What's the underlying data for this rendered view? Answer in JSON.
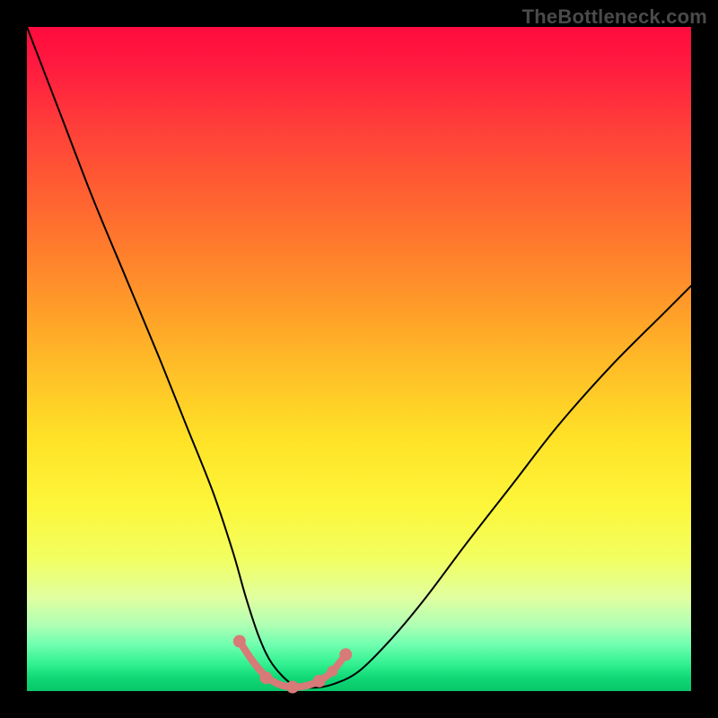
{
  "watermark": "TheBottleneck.com",
  "chart_data": {
    "type": "line",
    "title": "",
    "xlabel": "",
    "ylabel": "",
    "xlim": [
      0,
      100
    ],
    "ylim": [
      0,
      100
    ],
    "grid": false,
    "background_gradient": {
      "direction": "vertical",
      "stops": [
        {
          "pos": 0.0,
          "color": "#ff0b3e"
        },
        {
          "pos": 0.28,
          "color": "#ff6a2f"
        },
        {
          "pos": 0.5,
          "color": "#ffb927"
        },
        {
          "pos": 0.72,
          "color": "#fdf63a"
        },
        {
          "pos": 0.9,
          "color": "#b0ffb4"
        },
        {
          "pos": 1.0,
          "color": "#08c76a"
        }
      ]
    },
    "series": [
      {
        "name": "black-curve",
        "color": "#000000",
        "stroke_width": 2,
        "x": [
          0,
          5,
          10,
          15,
          20,
          24,
          28,
          31,
          33,
          35,
          37,
          40,
          43,
          46,
          50,
          55,
          60,
          66,
          73,
          80,
          88,
          96,
          100
        ],
        "y": [
          100,
          87,
          74,
          62,
          50,
          40,
          30,
          21,
          14,
          8,
          4,
          1,
          0.5,
          1,
          3,
          8,
          14,
          22,
          31,
          40,
          49,
          57,
          61
        ]
      },
      {
        "name": "salmon-marker-curve",
        "color": "#d77a78",
        "stroke_width": 8,
        "x": [
          32,
          34,
          36,
          38,
          40,
          42,
          44,
          46,
          48
        ],
        "y": [
          7.5,
          4.5,
          2.2,
          1.0,
          0.6,
          0.8,
          1.5,
          3.0,
          5.5
        ]
      }
    ],
    "markers": [
      {
        "x": 32,
        "y": 7.5,
        "r": 7,
        "color": "#d77a78"
      },
      {
        "x": 36,
        "y": 2.0,
        "r": 7,
        "color": "#d77a78"
      },
      {
        "x": 40,
        "y": 0.6,
        "r": 7,
        "color": "#d77a78"
      },
      {
        "x": 44,
        "y": 1.5,
        "r": 7,
        "color": "#d77a78"
      },
      {
        "x": 46,
        "y": 3.0,
        "r": 6,
        "color": "#d77a78"
      },
      {
        "x": 48,
        "y": 5.5,
        "r": 7,
        "color": "#d77a78"
      }
    ]
  }
}
